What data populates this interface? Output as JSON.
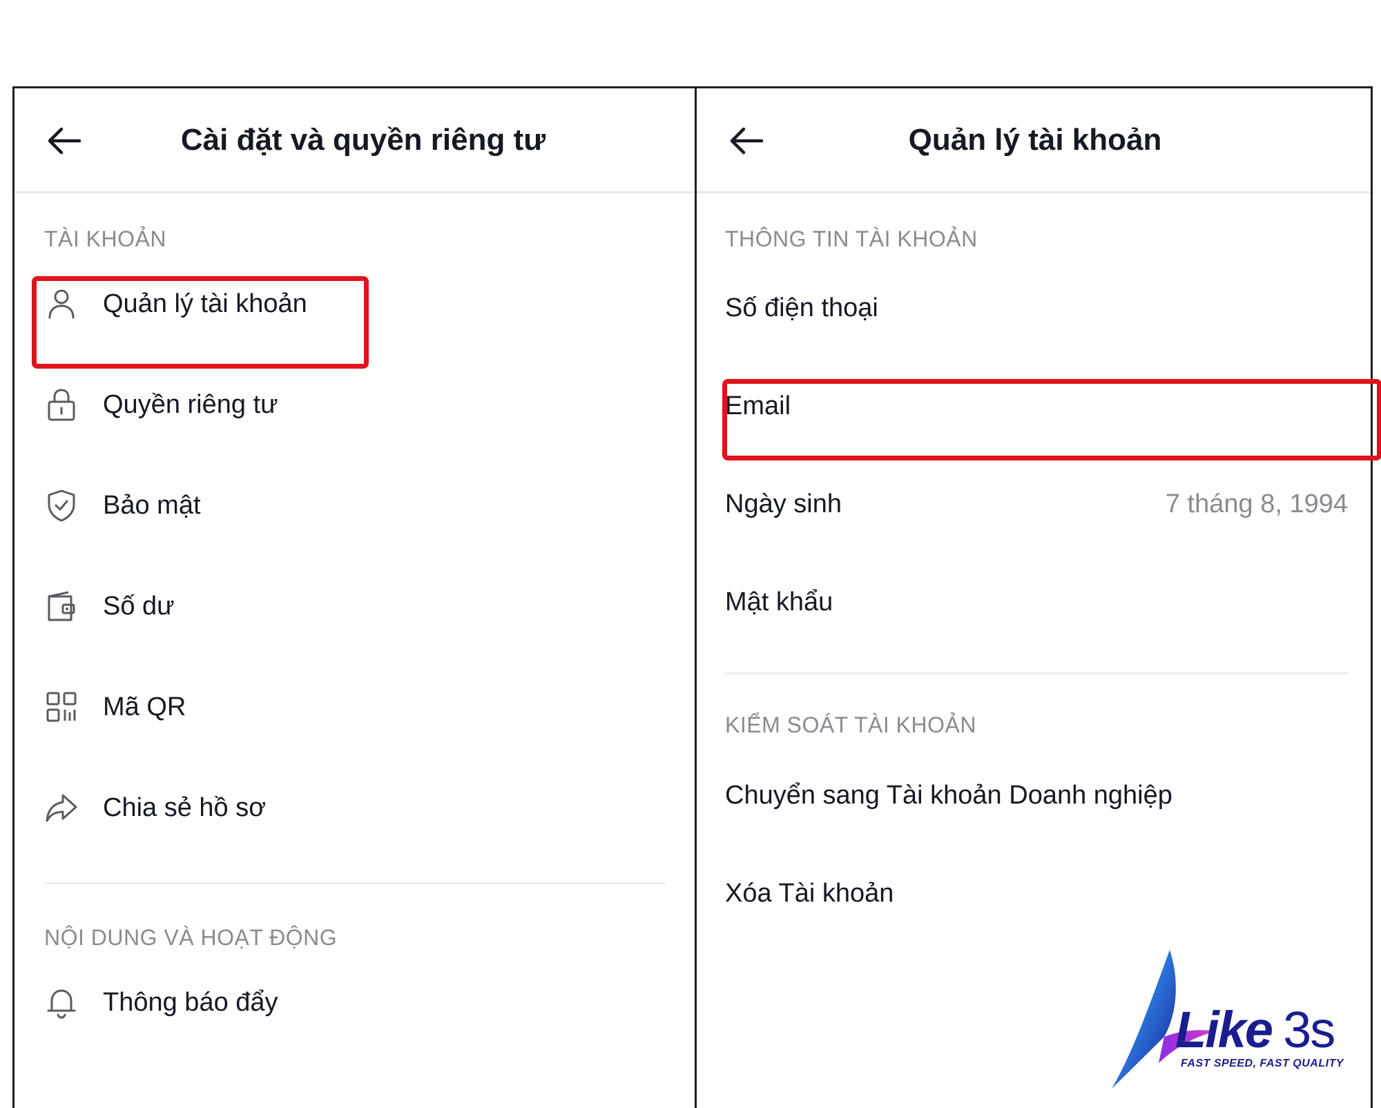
{
  "left_panel": {
    "title": "Cài đặt và quyền riêng tư",
    "sections": [
      {
        "label": "TÀI KHOẢN",
        "items": [
          {
            "label": "Quản lý tài khoản",
            "icon": "person-icon",
            "highlighted": true
          },
          {
            "label": "Quyền riêng tư",
            "icon": "lock-icon"
          },
          {
            "label": "Bảo mật",
            "icon": "shield-check-icon"
          },
          {
            "label": "Số dư",
            "icon": "wallet-icon"
          },
          {
            "label": "Mã QR",
            "icon": "qr-code-icon"
          },
          {
            "label": "Chia sẻ hồ sơ",
            "icon": "share-arrow-icon"
          }
        ]
      },
      {
        "label": "NỘI DUNG VÀ HOẠT ĐỘNG",
        "items": [
          {
            "label": "Thông báo đẩy",
            "icon": "bell-icon"
          }
        ]
      }
    ]
  },
  "right_panel": {
    "title": "Quản lý tài khoản",
    "sections": [
      {
        "label": "THÔNG TIN TÀI KHOẢN",
        "rows": [
          {
            "label": "Số điện thoại",
            "value": ""
          },
          {
            "label": "Email",
            "value": "",
            "highlighted": true
          },
          {
            "label": "Ngày sinh",
            "value": "7 tháng 8, 1994"
          },
          {
            "label": "Mật khẩu",
            "value": ""
          }
        ]
      },
      {
        "label": "KIỂM SOÁT TÀI KHOẢN",
        "rows": [
          {
            "label": "Chuyển sang Tài khoản Doanh nghiệp",
            "value": ""
          },
          {
            "label": "Xóa Tài khoản",
            "value": ""
          }
        ]
      }
    ]
  },
  "watermark": {
    "brand": "Like",
    "brand_suffix": "3s",
    "tagline": "FAST SPEED, FAST QUALITY"
  },
  "colors": {
    "highlight": "#e0131a",
    "text_primary": "#161823",
    "text_secondary": "#8a8b91",
    "logo_blue": "#1a1d8f"
  }
}
